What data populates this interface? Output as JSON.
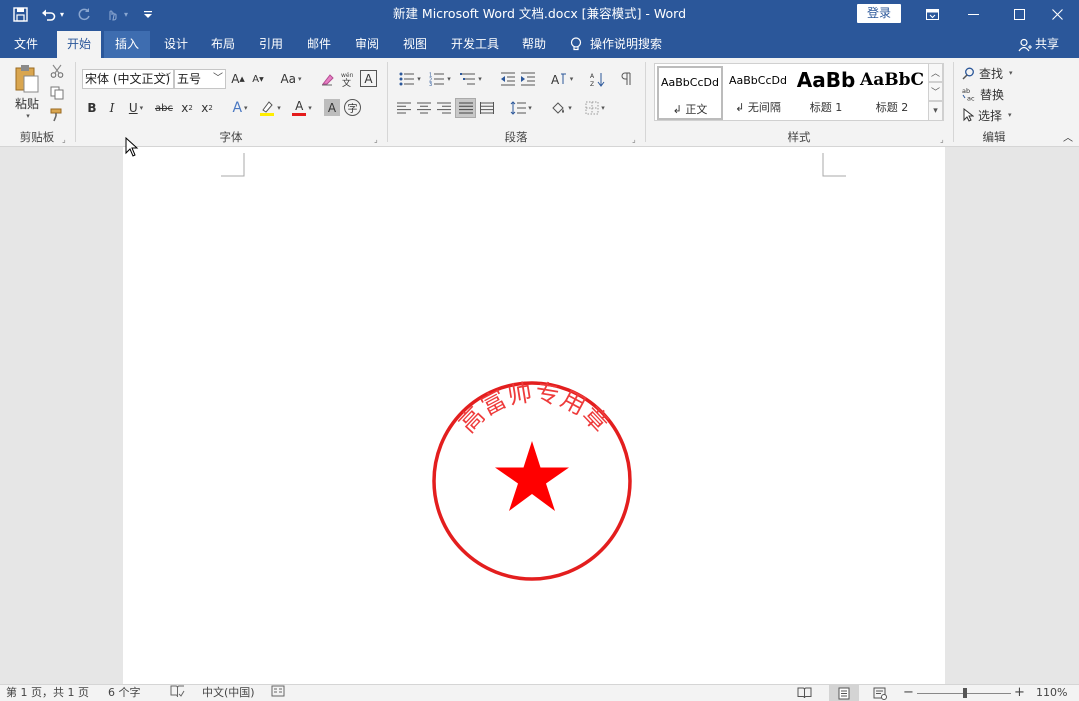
{
  "titlebar": {
    "title": "新建 Microsoft Word 文档.docx [兼容模式]  -  Word",
    "login": "登录"
  },
  "tabs": [
    {
      "label": "文件"
    },
    {
      "label": "开始"
    },
    {
      "label": "插入"
    },
    {
      "label": "设计"
    },
    {
      "label": "布局"
    },
    {
      "label": "引用"
    },
    {
      "label": "邮件"
    },
    {
      "label": "审阅"
    },
    {
      "label": "视图"
    },
    {
      "label": "开发工具"
    },
    {
      "label": "帮助"
    }
  ],
  "tell_me": "操作说明搜索",
  "share": "共享",
  "clipboard": {
    "paste": "粘贴",
    "label": "剪贴板"
  },
  "font": {
    "name": "宋体 (中文正文)",
    "size": "五号",
    "label": "字体",
    "grow": "A",
    "shrink": "A",
    "case": "Aa",
    "bold": "B",
    "italic": "I",
    "underline": "U",
    "strike": "abc",
    "sub": "x",
    "sup": "x",
    "color_a": "A",
    "shade_a": "A",
    "clear_a": "A",
    "enclose": "字"
  },
  "paragraph": {
    "label": "段落"
  },
  "styles": {
    "label": "样式",
    "items": [
      {
        "preview": "AaBbCcDd",
        "name": "↲ 正文"
      },
      {
        "preview": "AaBbCcDd",
        "name": "↲ 无间隔"
      },
      {
        "preview": "AaBb",
        "name": "标题 1"
      },
      {
        "preview": "AaBbC",
        "name": "标题 2"
      }
    ]
  },
  "editing": {
    "find": "查找",
    "replace": "替换",
    "select": "选择",
    "label": "编辑"
  },
  "seal": {
    "text": "高富帅专用章",
    "color": "#ee1c1c"
  },
  "status": {
    "pages": "第 1 页，共 1 页",
    "words": "6 个字",
    "language": "中文(中国)",
    "zoom": "110%"
  },
  "colors": {
    "brand": "#2b579a"
  }
}
